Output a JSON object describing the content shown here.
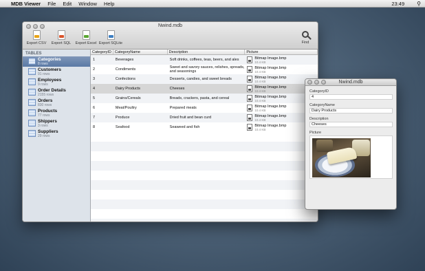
{
  "menubar": {
    "apple_glyph": "",
    "app_name": "MDB Viewer",
    "items": [
      "File",
      "Edit",
      "Window",
      "Help"
    ],
    "clock": "23:49",
    "spotlight_glyph": "⚲"
  },
  "main_window": {
    "title": "Nwind.mdb",
    "toolbar": [
      {
        "label": "Export CSV",
        "icon": "csv-file-icon",
        "color": "#e8a317"
      },
      {
        "label": "Export SQL",
        "icon": "sql-file-icon",
        "color": "#d9542b"
      },
      {
        "label": "Export Excel",
        "icon": "excel-file-icon",
        "color": "#5aa632"
      },
      {
        "label": "Export SQLite",
        "icon": "sqlite-file-icon",
        "color": "#3e7fc1"
      }
    ],
    "find_label": "Find",
    "sidebar": {
      "heading": "TABLES",
      "selected_index": 0,
      "tables": [
        {
          "name": "Categories",
          "rows": "8 rows"
        },
        {
          "name": "Customers",
          "rows": "91 rows"
        },
        {
          "name": "Employees",
          "rows": "9 rows"
        },
        {
          "name": "Order Details",
          "rows": "2155 rows"
        },
        {
          "name": "Orders",
          "rows": "830 rows"
        },
        {
          "name": "Products",
          "rows": "77 rows"
        },
        {
          "name": "Shippers",
          "rows": "3 rows"
        },
        {
          "name": "Suppliers",
          "rows": "29 rows"
        }
      ]
    },
    "table": {
      "columns": [
        "CategoryID",
        "CategoryName",
        "Description",
        "Picture"
      ],
      "selected_row": 3,
      "rows": [
        {
          "id": "1",
          "name": "Beverages",
          "desc": "Soft drinks, coffees, teas, beers, and ales",
          "pic": "Bitmap Image.bmp",
          "size": "10.4 KB"
        },
        {
          "id": "2",
          "name": "Condiments",
          "desc": "Sweet and savory sauces, relishes, spreads, and seasonings",
          "pic": "Bitmap Image.bmp",
          "size": "10.4 KB"
        },
        {
          "id": "3",
          "name": "Confections",
          "desc": "Desserts, candies, and sweet breads",
          "pic": "Bitmap Image.bmp",
          "size": "10.4 KB"
        },
        {
          "id": "4",
          "name": "Dairy Products",
          "desc": "Cheeses",
          "pic": "Bitmap Image.bmp",
          "size": "10.4 KB"
        },
        {
          "id": "5",
          "name": "Grains/Cereals",
          "desc": "Breads, crackers, pasta, and cereal",
          "pic": "Bitmap Image.bmp",
          "size": "10.4 KB"
        },
        {
          "id": "6",
          "name": "Meat/Poultry",
          "desc": "Prepared meats",
          "pic": "Bitmap Image.bmp",
          "size": "10.4 KB"
        },
        {
          "id": "7",
          "name": "Produce",
          "desc": "Dried fruit and bean curd",
          "pic": "Bitmap Image.bmp",
          "size": "10.4 KB"
        },
        {
          "id": "8",
          "name": "Seafood",
          "desc": "Seaweed and fish",
          "pic": "Bitmap Image.bmp",
          "size": "10.4 KB"
        }
      ]
    }
  },
  "detail_window": {
    "title": "Nwind.mdb",
    "fields": [
      {
        "label": "CategoryID",
        "value": "4"
      },
      {
        "label": "CategoryName",
        "value": "Dairy Products"
      },
      {
        "label": "Description",
        "value": "Cheeses"
      }
    ],
    "picture_label": "Picture",
    "picture_icon": "cheese-photo"
  }
}
